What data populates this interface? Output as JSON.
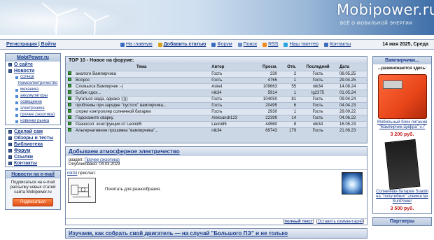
{
  "header": {
    "site_title": "Mobipower.ru",
    "tagline": "ВСЁ О МОБИЛЬНОЙ ЭНЕРГИИ"
  },
  "navbar": {
    "register_login": "Регистрация | Войти",
    "menu": [
      {
        "label": "На главную",
        "icon": "home-icon"
      },
      {
        "label": "Добавить статью",
        "icon": "add-article-icon"
      },
      {
        "label": "Форум",
        "icon": "forum-icon"
      },
      {
        "label": "Поиск",
        "icon": "search-icon"
      },
      {
        "label": "RSS",
        "icon": "rss-icon"
      },
      {
        "label": "Наш твиттер",
        "icon": "twitter-icon"
      },
      {
        "label": "Контакты",
        "icon": "contacts-icon"
      }
    ],
    "date": "14 мая 2025, Среда"
  },
  "sidebar": {
    "site_box": "MobiPower.ru",
    "items": [
      {
        "label": "О сайте"
      },
      {
        "label": "Новости"
      }
    ],
    "news_sub": [
      "солнце",
      "термоэлектричество",
      "механика",
      "аккумуляторы",
      "освещение",
      "электроника",
      "прочее (экзотика)",
      "новинки рынка"
    ],
    "items2": [
      {
        "label": "Сделай сам"
      },
      {
        "label": "Обзоры и тесты"
      },
      {
        "label": "Библиотека"
      },
      {
        "label": "Форум"
      },
      {
        "label": "Ссылки"
      },
      {
        "label": "Контакты"
      }
    ],
    "email_box": {
      "title": "Новости на e-mail",
      "text": "Подписаться на e-mail рассылку новых статей сайта Mobipower.ru",
      "button": "Подписаться"
    }
  },
  "top10": {
    "title": "TOP 10 - Новое на форуме:",
    "columns": [
      "Тема",
      "Автор",
      "Просм.",
      "Отв.",
      "Последний",
      "Дата"
    ],
    "rows": [
      [
        "аналоги Вампирчика",
        "Гость",
        "230",
        "2",
        "Гость",
        "08.05.25"
      ],
      [
        "Вопрос",
        "Гость",
        "4765",
        "1",
        "Гость",
        "29.04.25"
      ],
      [
        "Сломался Вампирчик :-(",
        "Asket",
        "109663",
        "55",
        "nik34",
        "14.08.24"
      ],
      [
        "Бобик сдох...",
        "nik34",
        "5914",
        "1",
        "lg2375",
        "01.05.24"
      ],
      [
        "Ругаться сюда, однако :))))",
        "Гость",
        "104050",
        "81",
        "Гость",
        "09.04.24"
      ],
      [
        "проблемы при зарядке \"пустого\" вампирчика...",
        "Гость",
        "20495",
        "6",
        "Гость",
        "04.04.23"
      ],
      [
        "сгорел контроллер солнечной батареи",
        "Гость",
        "2930",
        "1",
        "Гость",
        "29.09.22"
      ],
      [
        "Подскажите сварку.",
        "Aleksandr123",
        "22399",
        "14",
        "Гость",
        "04.06.22"
      ],
      [
        "Разносол: конструкции от Leonid5",
        "Leonid5",
        "44560",
        "8",
        "nik34",
        "16.05.23"
      ],
      [
        "Альтернативное прошивка \"вампирчика\"...",
        "nik34",
        "69743",
        "179",
        "Гость",
        "21.06.23"
      ]
    ]
  },
  "article": {
    "title": "Добываем атмосферное электричество",
    "section_label": "раздел:",
    "section": "Прочее (экзотика)",
    "published_label": "Опубликовано:",
    "published": "04.03.2023",
    "author": "nik34",
    "author_suffix": "прислал:",
    "text": "Почитать для разнообразия.",
    "full_text": "полный текст",
    "comment": "Оставить комментарий"
  },
  "article2": {
    "title": "Изучаем, как собрать свой двигатель — на случай \"Большого ПЭ\" и не только"
  },
  "right": {
    "title": "Вампирчики...",
    "intro": "...размножаются здесь:",
    "product1": "Мобильный блок питания \"Вампирчик-Цифра\" v.7",
    "price1": "3 200 руб.",
    "product2": "Солнечная батарея Suaoki на \"полугибких\" элементах SunPower",
    "price2": "3 500 руб.",
    "partners": "Партнеры"
  }
}
